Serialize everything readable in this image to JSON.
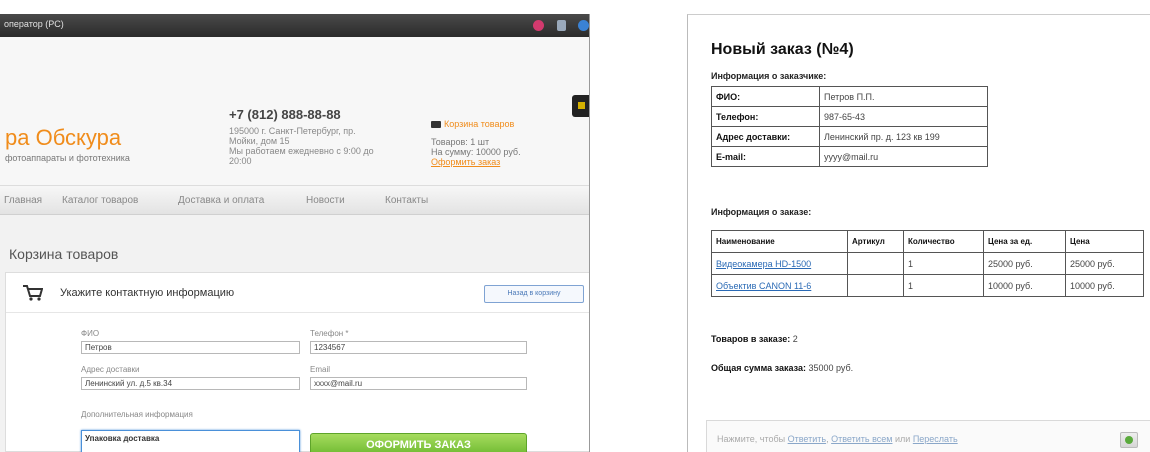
{
  "left": {
    "window_title": "оператор (PC)",
    "logo": "ра Обскура",
    "logo_sub": "фотоаппараты и фототехника",
    "phone": "+7 (812) 888-88-88",
    "address_lines": [
      "195000 г. Санкт-Петербург, пр.",
      "Мойки, дом 15",
      "Мы работаем ежедневно с 9:00 до",
      "20:00"
    ],
    "cart": {
      "title": "Корзина товаров",
      "items": "Товаров: 1 шт",
      "sum": "На сумму: 10000 руб.",
      "checkout": "Оформить заказ"
    },
    "nav": [
      "Главная",
      "Каталог товаров",
      "Доставка и оплата",
      "Новости",
      "Контакты"
    ],
    "page_title": "Корзина товаров",
    "form": {
      "header": "Укажите контактную информацию",
      "back": "Назад в корзину",
      "fio_label": "ФИО",
      "fio_value": "Петров",
      "phone_label": "Телефон *",
      "phone_value": "1234567",
      "address_label": "Адрес доставки",
      "address_value": "Ленинский ул. д.5 кв.34",
      "email_label": "Email",
      "email_value": "xxxx@mail.ru",
      "comment_label": "Дополнительная информация",
      "comment_value": "Упаковка доставка",
      "submit": "ОФОРМИТЬ ЗАКАЗ"
    }
  },
  "right": {
    "title": "Новый заказ (№4)",
    "customer_label": "Информация о заказчике:",
    "customer": [
      {
        "k": "ФИО:",
        "v": "Петров П.П."
      },
      {
        "k": "Телефон:",
        "v": "987-65-43"
      },
      {
        "k": "Адрес доставки:",
        "v": "Ленинский пр. д. 123 кв 199"
      },
      {
        "k": "E-mail:",
        "v": "yyyy@mail.ru"
      }
    ],
    "order_label": "Информация о заказе:",
    "columns": [
      "Наименование",
      "Артикул",
      "Количество",
      "Цена за ед.",
      "Цена"
    ],
    "rows": [
      {
        "name": "Видеокамера HD-1500",
        "sku": "",
        "qty": "1",
        "unit": "25000 руб.",
        "price": "25000 руб."
      },
      {
        "name": "Объектив CANON 11-6",
        "sku": "",
        "qty": "1",
        "unit": "10000 руб.",
        "price": "10000 руб."
      }
    ],
    "items_count_label": "Товаров в заказе:",
    "items_count": "2",
    "total_label": "Общая сумма заказа:",
    "total": "35000 руб.",
    "comment_bar": {
      "prefix": "Нажмите, чтобы",
      "reply": "Ответить",
      "reply_all": "Ответить всем",
      "or": "или",
      "forward": "Переслать"
    }
  },
  "colors": {
    "brand_orange": "#f08c1b",
    "submit_green": "#6cb82f",
    "link_blue": "#2a6ab5"
  }
}
